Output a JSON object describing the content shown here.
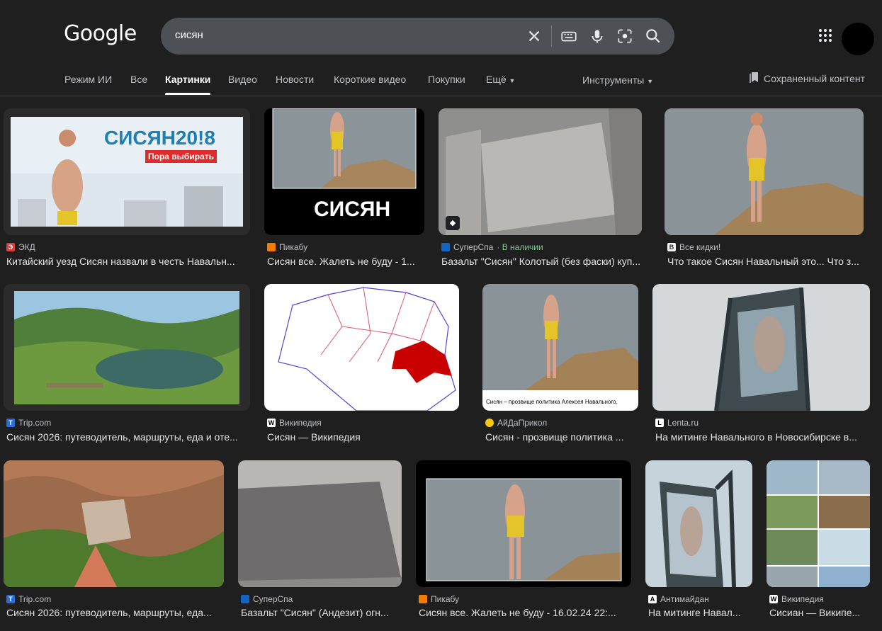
{
  "logo": "Google",
  "search": {
    "query": "сисян"
  },
  "tabs": [
    "Режим ИИ",
    "Все",
    "Картинки",
    "Видео",
    "Новости",
    "Короткие видео",
    "Покупки",
    "Ещё"
  ],
  "tools_label": "Инструменты",
  "saved_label": "Сохраненный контент",
  "results": [
    {
      "source": "ЭКД",
      "title": "Китайский уезд Сисян назвали в честь Навальн...",
      "thumb_text": "СИСЯН20!8",
      "thumb_sub": "Пора выбирать"
    },
    {
      "source": "Пикабу",
      "title": "Сисян все. Жалеть не буду - 1...",
      "thumb_text": "СИСЯН"
    },
    {
      "source": "СуперСпа",
      "availability": "· В наличии",
      "title": "Базальт \"Сисян\" Колотый (без фаски) куп..."
    },
    {
      "source": "Все кидки!",
      "title": "Что такое Сисян Навальный это... Что з..."
    },
    {
      "source": "Trip.com",
      "title": "Сисян 2026: путеводитель, маршруты, еда и оте..."
    },
    {
      "source": "Википедия",
      "title": "Сисян — Википедия"
    },
    {
      "source": "АйДаПрикол",
      "title": "Сисян - прозвище политика ...",
      "thumb_caption": "Сисян – прозвище политика Алексея Навального,"
    },
    {
      "source": "Lenta.ru",
      "title": "На митинге Навального в Новосибирске в..."
    },
    {
      "source": "Trip.com",
      "title": "Сисян 2026: путеводитель, маршруты, еда..."
    },
    {
      "source": "СуперСпа",
      "title": "Базальт \"Сисян\" (Андезит) огн..."
    },
    {
      "source": "Пикабу",
      "title": "Сисян все. Жалеть не буду - 16.02.24 22:..."
    },
    {
      "source": "Антимайдан",
      "title": "На митинге Навал..."
    },
    {
      "source": "Википедия",
      "title": "Сисиан — Википе..."
    }
  ]
}
